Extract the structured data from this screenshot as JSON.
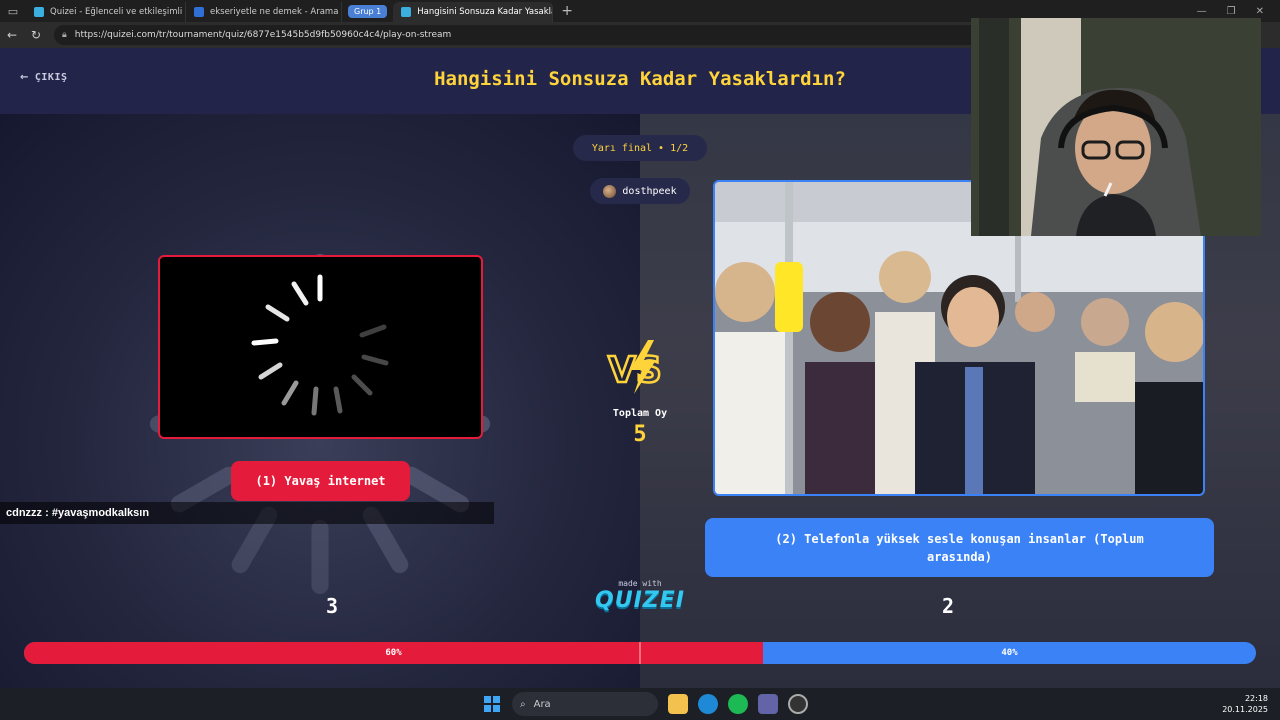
{
  "browser": {
    "tabs": [
      {
        "label": "Quizei - Eğlenceli ve etkileşimli q",
        "active": false,
        "favicon_color": "#3bb0e0"
      },
      {
        "label": "ekseriyetle ne demek - Arama",
        "active": false,
        "favicon_color": "#2f6fd6"
      },
      {
        "label": "Hangisini Sonsuza Kadar Yasakla",
        "active": true,
        "favicon_color": "#3bb0e0"
      }
    ],
    "group_label": "Grup 1",
    "url": "https://quizei.com/tr/tournament/quiz/6877e1545b5d9fb50960c4c4/play-on-stream"
  },
  "header": {
    "exit_label": "ÇIKIŞ",
    "title": "Hangisini Sonsuza Kadar Yasaklardın?"
  },
  "round": {
    "label": "Yarı final • 1/2"
  },
  "user": {
    "name": "dosthpeek"
  },
  "left_option": {
    "label": "(1) Yavaş internet",
    "votes": "3",
    "percent": "60%",
    "percent_value": 60,
    "color": "#e51b3b"
  },
  "right_option": {
    "label": "(2) Telefonla yüksek sesle konuşan insanlar (Toplum arasında)",
    "votes": "2",
    "percent": "40%",
    "percent_value": 40,
    "color": "#3b82f6"
  },
  "total": {
    "label": "Toplam Oy",
    "value": "5"
  },
  "chat": {
    "user": "cdnzzz",
    "message": "#yavaşmodkalksın"
  },
  "branding": {
    "made_with": "made with",
    "logo": "QUIZEI"
  },
  "taskbar": {
    "search_placeholder": "Ara",
    "time": "22:18",
    "date": "20.11.2025"
  },
  "icons": [
    "tab-actions-icon",
    "back-icon",
    "refresh-icon",
    "lock-icon",
    "new-tab-icon",
    "arrow-left-icon",
    "loading-spinner-icon",
    "vs-icon",
    "windows-start-icon",
    "search-icon",
    "file-explorer-icon",
    "edge-icon",
    "spotify-icon",
    "teams-icon",
    "app-icon"
  ]
}
